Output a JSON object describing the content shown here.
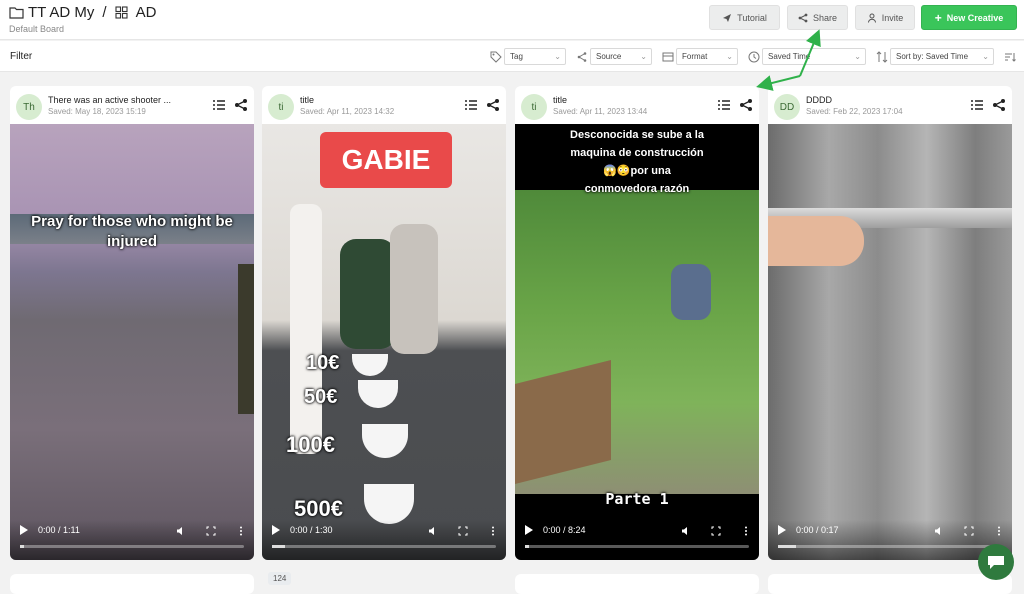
{
  "header": {
    "workspace": "TT AD My",
    "separator": "/",
    "board": "AD",
    "subtitle": "Default Board",
    "tutorial_label": "Tutorial",
    "share_label": "Share",
    "invite_label": "Invite",
    "new_creative_label": "New Creative"
  },
  "toolbar": {
    "filter_label": "Filter",
    "tag_label": "Tag",
    "source_label": "Source",
    "format_label": "Format",
    "saved_time_label": "Saved Time",
    "sort_label": "Sort by: Saved Time"
  },
  "cards": [
    {
      "initials": "Th",
      "title": "There was an active shooter ...",
      "saved": "Saved: May 18, 2023 15:19",
      "time": "0:00 / 1:11",
      "overlay": "Pray for those who might be injured"
    },
    {
      "initials": "ti",
      "title": "title",
      "saved": "Saved: Apr 11, 2023 14:32",
      "time": "0:00 / 1:30",
      "overlay": "GABIE",
      "prices": [
        "10€",
        "50€",
        "100€",
        "500€"
      ]
    },
    {
      "initials": "ti",
      "title": "title",
      "saved": "Saved: Apr 11, 2023 13:44",
      "time": "0:00 / 8:24",
      "overlay_line1": "Desconocida se sube a la",
      "overlay_line2": "maquina de construcción",
      "overlay_line3": "😱😳por una",
      "overlay_line4": "conmovedora razón",
      "bottom_caption": "Parte 1"
    },
    {
      "initials": "DD",
      "title": "DDDD",
      "saved": "Saved: Feb 22, 2023 17:04",
      "time": "0:00 / 0:17"
    }
  ],
  "footer": {
    "count_badge": "124"
  },
  "colors": {
    "accent_green": "#3ac55a",
    "avatar_bg": "#d7ecd0",
    "chat_bg": "#2f7a3e"
  }
}
